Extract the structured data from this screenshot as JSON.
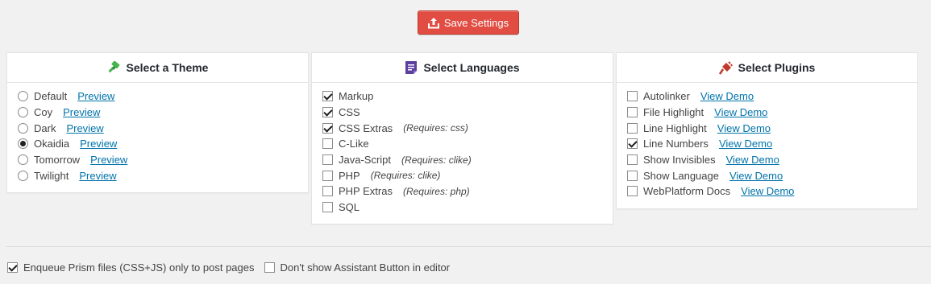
{
  "toolbar": {
    "save_label": "Save Settings",
    "save_icon": "upload-icon",
    "accent": "#e14d43"
  },
  "themes": {
    "title": "Select a Theme",
    "icon": "paintbrush-icon",
    "icon_color": "#46b450",
    "link_color": "#0073aa",
    "items": [
      {
        "label": "Default",
        "link": "Preview",
        "selected": false
      },
      {
        "label": "Coy",
        "link": "Preview",
        "selected": false
      },
      {
        "label": "Dark",
        "link": "Preview",
        "selected": false
      },
      {
        "label": "Okaidia",
        "link": "Preview",
        "selected": true
      },
      {
        "label": "Tomorrow",
        "link": "Preview",
        "selected": false
      },
      {
        "label": "Twilight",
        "link": "Preview",
        "selected": false
      }
    ]
  },
  "languages": {
    "title": "Select Languages",
    "icon": "document-list-icon",
    "icon_color": "#5d3fa0",
    "items": [
      {
        "label": "Markup",
        "requires": "",
        "checked": true
      },
      {
        "label": "CSS",
        "requires": "",
        "checked": true
      },
      {
        "label": "CSS Extras",
        "requires": "(Requires: css)",
        "checked": true
      },
      {
        "label": "C-Like",
        "requires": "",
        "checked": false
      },
      {
        "label": "Java-Script",
        "requires": "(Requires: clike)",
        "checked": false
      },
      {
        "label": "PHP",
        "requires": "(Requires: clike)",
        "checked": false
      },
      {
        "label": "PHP Extras",
        "requires": "(Requires: php)",
        "checked": false
      },
      {
        "label": "SQL",
        "requires": "",
        "checked": false
      }
    ]
  },
  "plugins": {
    "title": "Select Plugins",
    "icon": "plug-icon",
    "icon_color": "#c0392b",
    "items": [
      {
        "label": "Autolinker",
        "link": "View Demo",
        "checked": false
      },
      {
        "label": "File Highlight",
        "link": "View Demo",
        "checked": false
      },
      {
        "label": "Line Highlight",
        "link": "View Demo",
        "checked": false
      },
      {
        "label": "Line Numbers",
        "link": "View Demo",
        "checked": true
      },
      {
        "label": "Show Invisibles",
        "link": "View Demo",
        "checked": false
      },
      {
        "label": "Show Language",
        "link": "View Demo",
        "checked": false
      },
      {
        "label": "WebPlatform Docs",
        "link": "View Demo",
        "checked": false
      }
    ]
  },
  "footer": {
    "options": [
      {
        "label": "Enqueue Prism files (CSS+JS) only to post pages",
        "checked": true
      },
      {
        "label": "Don't show Assistant Button in editor",
        "checked": false
      }
    ]
  }
}
